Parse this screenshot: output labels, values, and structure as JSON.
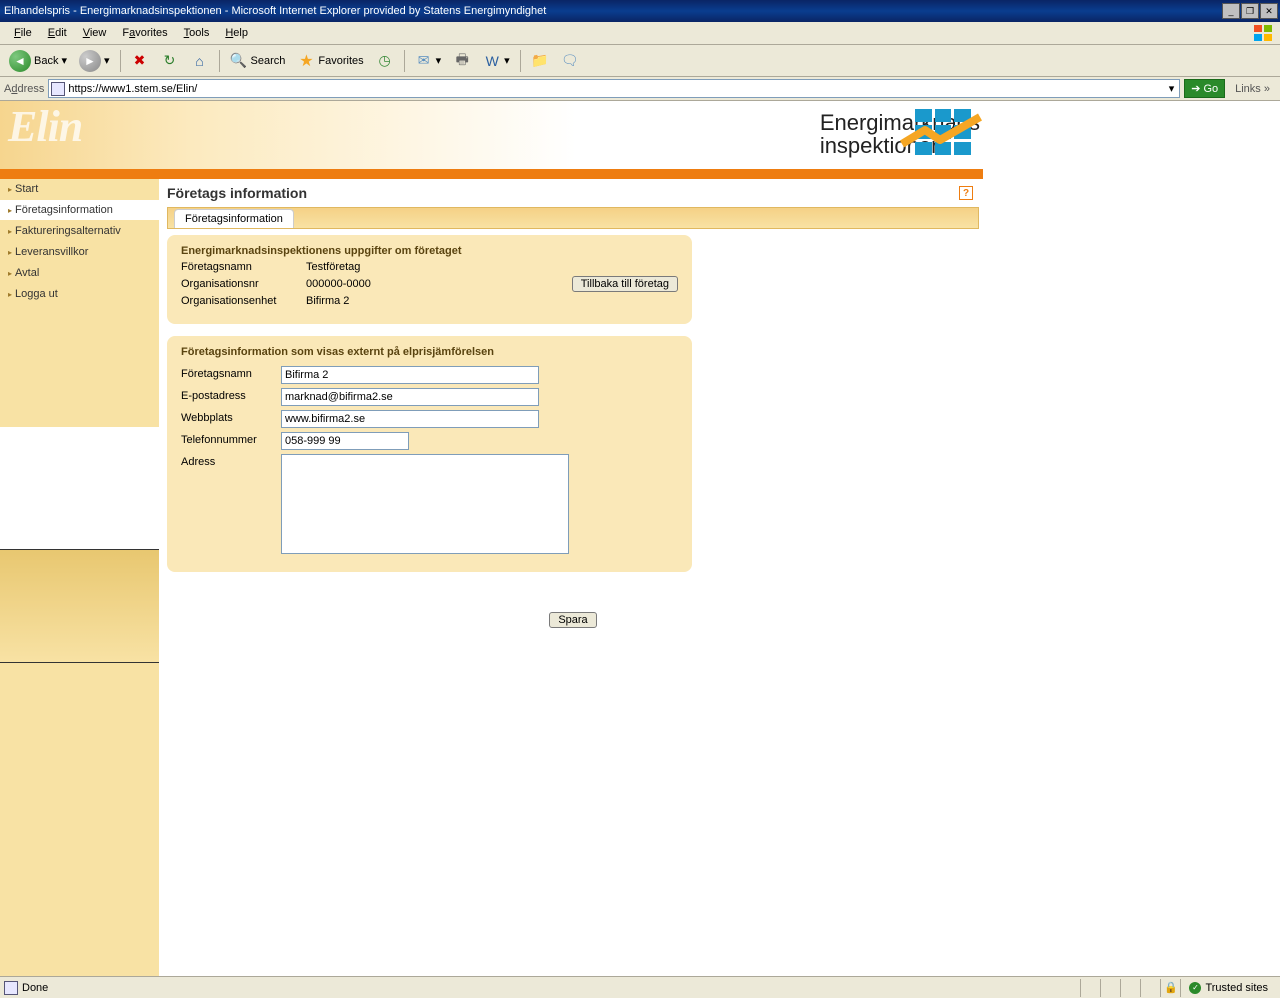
{
  "window": {
    "title": "Elhandelspris - Energimarknadsinspektionen - Microsoft Internet Explorer provided by Statens Energimyndighet"
  },
  "menubar": {
    "items": [
      "File",
      "Edit",
      "View",
      "Favorites",
      "Tools",
      "Help"
    ]
  },
  "toolbar": {
    "back": "Back",
    "search": "Search",
    "favorites": "Favorites"
  },
  "addressbar": {
    "label": "Address",
    "url": "https://www1.stem.se/Elin/",
    "go": "Go",
    "links": "Links"
  },
  "brand": {
    "line1": "Energimarknads",
    "line2": "inspektionen",
    "elin": "Elin"
  },
  "sidebar": {
    "items": [
      {
        "label": "Start"
      },
      {
        "label": "Företagsinformation",
        "active": true
      },
      {
        "label": "Faktureringsalternativ"
      },
      {
        "label": "Leveransvillkor"
      },
      {
        "label": "Avtal"
      },
      {
        "label": "Logga ut"
      }
    ]
  },
  "page_title": "Företags information",
  "tab_label": "Företagsinformation",
  "info_panel": {
    "heading": "Energimarknadsinspektionens uppgifter om företaget",
    "rows": [
      {
        "label": "Företagsnamn",
        "value": "Testföretag"
      },
      {
        "label": "Organisationsnr",
        "value": "000000-0000"
      },
      {
        "label": "Organisationsenhet",
        "value": "Bifirma 2"
      }
    ],
    "back_btn": "Tillbaka till företag"
  },
  "form_panel": {
    "heading": "Företagsinformation som visas externt på elprisjämförelsen",
    "fields": {
      "company_label": "Företagsnamn",
      "company_value": "Bifirma 2",
      "email_label": "E-postadress",
      "email_value": "marknad@bifirma2.se",
      "web_label": "Webbplats",
      "web_value": "www.bifirma2.se",
      "phone_label": "Telefonnummer",
      "phone_value": "058-999 99",
      "address_label": "Adress",
      "address_value": ""
    }
  },
  "save_btn": "Spara",
  "statusbar": {
    "done": "Done",
    "zone": "Trusted sites"
  }
}
